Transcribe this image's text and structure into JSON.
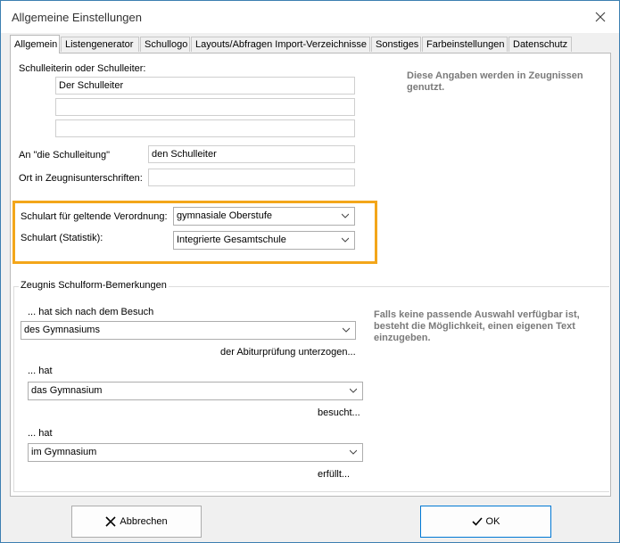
{
  "window": {
    "title": "Allgemeine Einstellungen"
  },
  "tabs": [
    {
      "label": "Allgemein"
    },
    {
      "label": "Listengenerator"
    },
    {
      "label": "Schullogo"
    },
    {
      "label": "Layouts/Abfragen Import-Verzeichnisse"
    },
    {
      "label": "Sonstiges"
    },
    {
      "label": "Farbeinstellungen"
    },
    {
      "label": "Datenschutz"
    }
  ],
  "general": {
    "principal_label": "Schulleiterin oder Schulleiter:",
    "principal_line1": "Der Schulleiter",
    "principal_line2": "",
    "principal_line3": "",
    "an_label": "An \"die Schulleitung\"",
    "an_value": "den Schulleiter",
    "ort_label": "Ort in Zeugnisunterschriften:",
    "ort_value": "",
    "hint": "Diese Angaben werden in Zeugnissen genutzt.",
    "schulart_label": "Schulart für geltende Verordnung:",
    "schulart_value": "gymnasiale Oberstufe",
    "statistik_label": "Schulart (Statistik):",
    "statistik_value": "Integrierte Gesamtschule"
  },
  "remarks": {
    "group_title": "Zeugnis Schulform-Bemerkungen",
    "line1_label": "... hat sich nach dem Besuch",
    "line1_value": "des Gymnasiums",
    "line1_suffix": "der Abiturprüfung  unterzogen...",
    "line2_label": "... hat",
    "line2_value": "das Gymnasium",
    "line2_suffix": "besucht...",
    "line3_label": "... hat",
    "line3_value": "im Gymnasium",
    "line3_suffix": "erfüllt...",
    "hint": "Falls keine passende Auswahl verfügbar ist, besteht die Möglichkeit, einen eigenen Text einzugeben."
  },
  "buttons": {
    "cancel": "Abbrechen",
    "ok": "OK"
  },
  "colors": {
    "highlight": "#f3a61a",
    "hint_text": "#7a7a7a",
    "ok_border": "#0078d4"
  }
}
